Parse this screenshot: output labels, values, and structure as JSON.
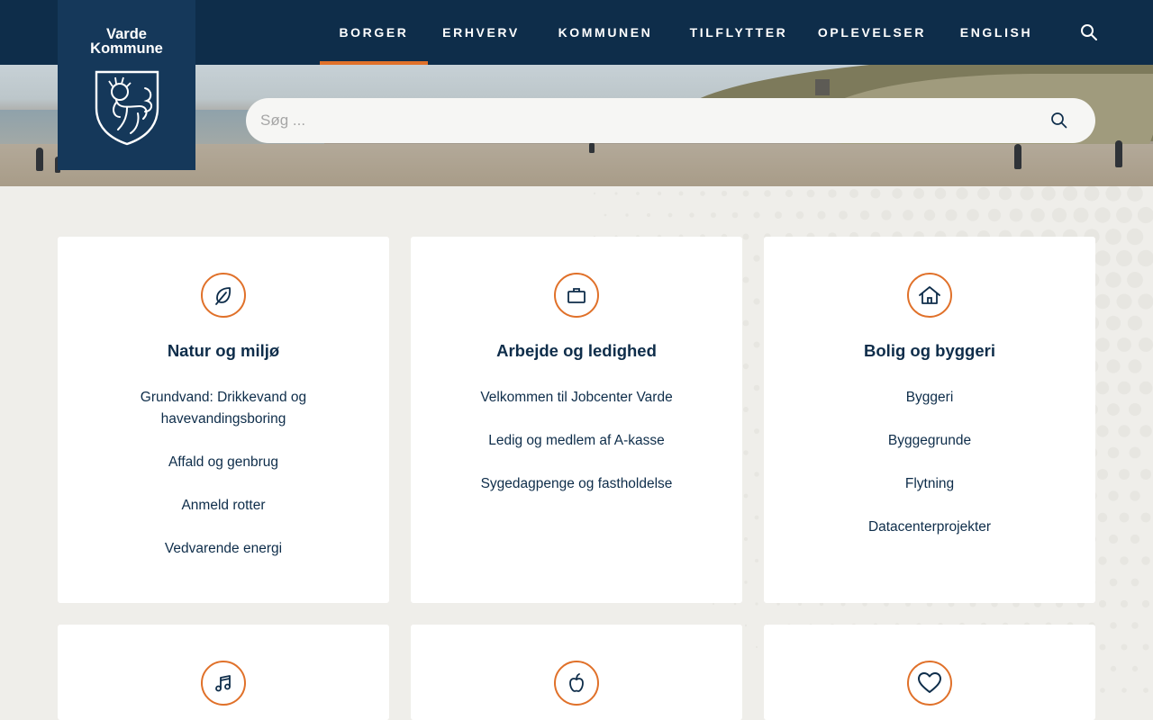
{
  "brand": {
    "line1": "Varde",
    "line2": "Kommune"
  },
  "nav": {
    "items": [
      {
        "label": "BORGER",
        "active": true
      },
      {
        "label": "ERHVERV",
        "active": false
      },
      {
        "label": "KOMMUNEN",
        "active": false
      },
      {
        "label": "TILFLYTTER",
        "active": false
      },
      {
        "label": "OPLEVELSER",
        "active": false
      },
      {
        "label": "ENGLISH",
        "active": false
      }
    ],
    "search_icon": "search-icon"
  },
  "search": {
    "placeholder": "Søg ...",
    "value": "",
    "icon": "search-icon"
  },
  "colors": {
    "navy": "#0e2d4a",
    "accent": "#e0712a",
    "background": "#efeeea",
    "card": "#ffffff"
  },
  "cards": [
    {
      "title": "Natur og miljø",
      "icon": "leaf-icon",
      "links": [
        "Grundvand: Drikkevand og havevandingsboring",
        "Affald og genbrug",
        "Anmeld rotter",
        "Vedvarende energi"
      ]
    },
    {
      "title": "Arbejde og ledighed",
      "icon": "briefcase-icon",
      "links": [
        "Velkommen til Jobcenter Varde",
        "Ledig og medlem af A-kasse",
        "Sygedagpenge og fastholdelse"
      ]
    },
    {
      "title": "Bolig og byggeri",
      "icon": "house-icon",
      "links": [
        "Byggeri",
        "Byggegrunde",
        "Flytning",
        "Datacenterprojekter"
      ]
    },
    {
      "title": "",
      "icon": "music-note-icon",
      "links": []
    },
    {
      "title": "",
      "icon": "apple-icon",
      "links": []
    },
    {
      "title": "",
      "icon": "heart-icon",
      "links": []
    }
  ]
}
